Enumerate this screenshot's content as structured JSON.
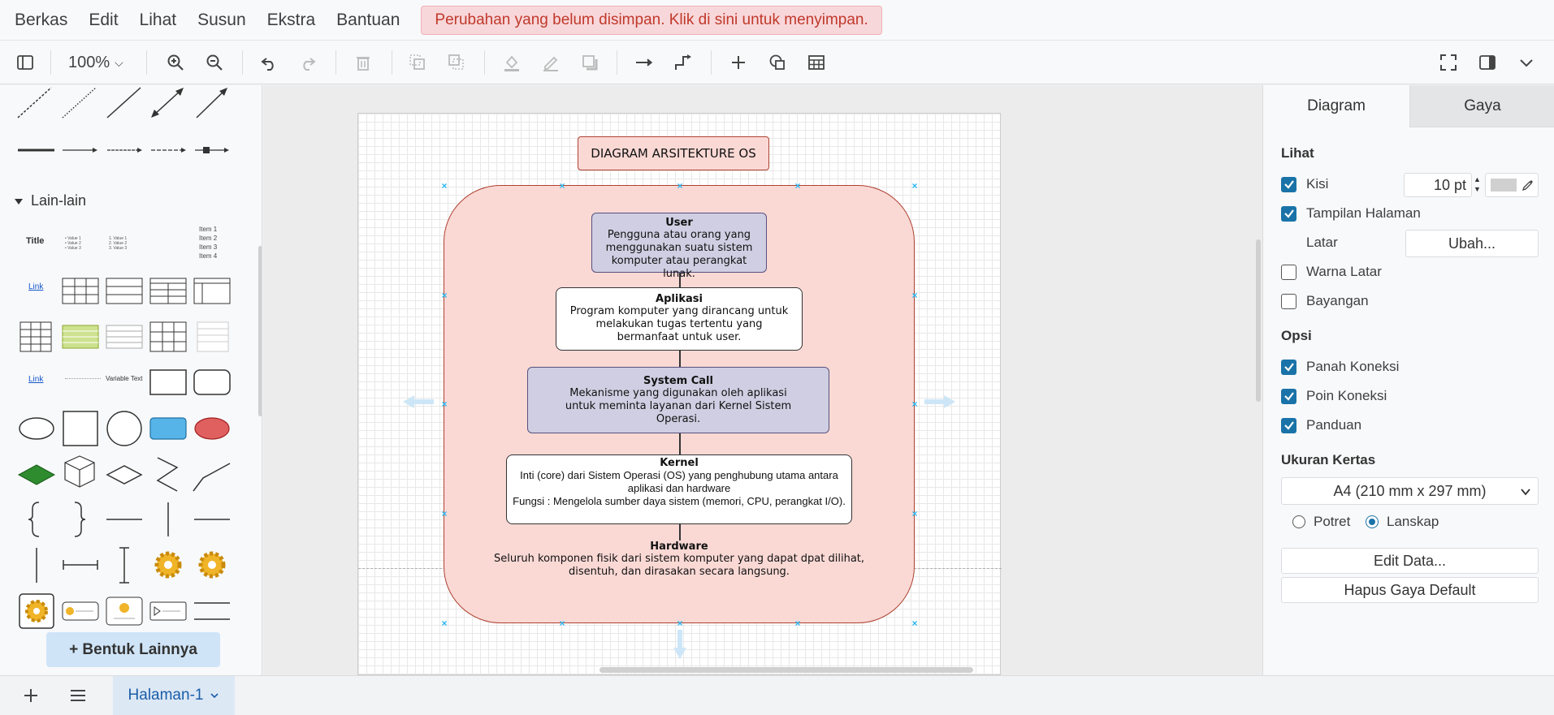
{
  "menu": [
    "Berkas",
    "Edit",
    "Lihat",
    "Susun",
    "Ekstra",
    "Bantuan"
  ],
  "unsaved_notice": "Perubahan yang belum disimpan. Klik di sini untuk menyimpan.",
  "toolbar": {
    "zoom": "100%"
  },
  "sidebar": {
    "section_title": "Lain-lain",
    "palette_title": "Title",
    "palette_link": "Link",
    "palette_link2": "Link",
    "palette_variable_text": "Variable Text",
    "palette_items_list": [
      "Item 1",
      "Item 2",
      "Item 3",
      "Item 4"
    ],
    "more_shapes": "+ Bentuk Lainnya"
  },
  "diagram": {
    "title": "DIAGRAM ARSITEKTURE OS",
    "user": {
      "title": "User",
      "text": "Pengguna atau orang yang menggunakan suatu sistem komputer atau perangkat lunak."
    },
    "aplikasi": {
      "title": "Aplikasi",
      "text": "Program komputer yang dirancang untuk melakukan tugas tertentu yang bermanfaat untuk user."
    },
    "syscall": {
      "title": "System Call",
      "text": "Mekanisme yang digunakan oleh aplikasi untuk meminta layanan dari Kernel Sistem Operasi."
    },
    "kernel": {
      "title": "Kernel",
      "text1": "Inti (core) dari Sistem Operasi (OS) yang penghubung utama antara aplikasi dan hardware",
      "text2": "Fungsi : Mengelola sumber daya sistem (memori, CPU, perangkat I/O)."
    },
    "hardware": {
      "title": "Hardware",
      "text": "Seluruh komponen fisik dari sistem komputer yang dapat dpat dilihat, disentuh, dan dirasakan secara langsung."
    },
    "colors": {
      "outer_fill": "#fad9d5",
      "outer_stroke": "#ae4132",
      "purple_fill": "#d0cee2",
      "purple_stroke": "#56517e"
    }
  },
  "panel": {
    "tab_diagram": "Diagram",
    "tab_style": "Gaya",
    "view_heading": "Lihat",
    "grid_label": "Kisi",
    "grid_size": "10 pt",
    "page_view_label": "Tampilan Halaman",
    "background_label": "Latar",
    "change_button": "Ubah...",
    "bg_color_label": "Warna Latar",
    "shadow_label": "Bayangan",
    "options_heading": "Opsi",
    "connection_arrows": "Panah Koneksi",
    "connection_points": "Poin Koneksi",
    "guides": "Panduan",
    "paper_size_heading": "Ukuran Kertas",
    "paper_size_value": "A4 (210 mm x 297 mm)",
    "portrait": "Potret",
    "landscape": "Lanskap",
    "edit_data": "Edit Data...",
    "reset_style": "Hapus Gaya Default"
  },
  "footer": {
    "page_tab": "Halaman-1"
  }
}
